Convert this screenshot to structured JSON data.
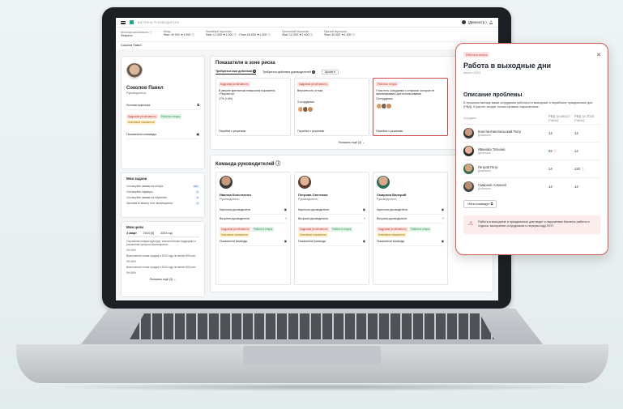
{
  "app": {
    "crumb": "ВИТРИНА РУКОВОДИТЕЛЯ",
    "user_label": "(Демонстр.)"
  },
  "stats": [
    {
      "label": "Штатная численность ⓘ",
      "value": "Февраль"
    },
    {
      "label": "Фонд:",
      "value": "Факт 40 000 ▼1 000 ⓘ"
    },
    {
      "label": "Линейный персонал:",
      "value": "Факт 12 000 ▼1 000 ⓘ · План 16 000 ▼1 000 ⓘ"
    },
    {
      "label": "Проектный персонал:",
      "value": "Факт 12 000 ▼1 000 ⓘ"
    },
    {
      "label": "Прочий персонал:",
      "value": "Факт 40 000 ▼1 000 ⓘ"
    }
  ],
  "page_owner": "Соколов Павел",
  "profile": {
    "name": "Соколов Павел",
    "role": "Руководитель",
    "personal_card": "Личная карточка",
    "tags": [
      "Кадровая устойчивость",
      "Работа в отпуск",
      "Ключевые показатели"
    ],
    "team_metrics": "Показатели команды"
  },
  "tasks": {
    "title": "Мои задачи",
    "items": [
      {
        "label": "Согласуйте заявки на отпуск",
        "badge": "99+"
      },
      {
        "label": "Согласуйте офферы",
        "badge": "2"
      },
      {
        "label": "Согласуйте заявки на обучение",
        "badge": "2"
      },
      {
        "label": "Заполните анкету тест-мониторинга",
        "badge": "3"
      }
    ]
  },
  "goals": {
    "title": "Мои цели",
    "tabs": [
      "3 кварт",
      "2024 (6)",
      "2024 год"
    ],
    "items": [
      "Улучшение инфраструктуры, аналитическая поддержка и улучшение процесса мониторинга...",
      "Выполнение плана продаж в 2023 году не менее 800 млн",
      "Выполнение плана продаж в 2023 году не менее 800 млн"
    ],
    "progress": [
      "0%   50%",
      "0%   50%",
      "0%   50%"
    ],
    "show_more": "Показать ещё (3)  ⌄"
  },
  "risk": {
    "title": "Показатели в зоне риска",
    "tab_action": "Требуются мои действия",
    "tab_action_count": "3",
    "tab_managers": "Требуются действия руководителей",
    "tab_managers_count": "3",
    "filter": "Архив ▾",
    "cards": [
      {
        "tag": "Кадровая устойчивость",
        "text": "В августе критически повысился показатель «Текучесть»",
        "extra": "17% (+4%)",
        "go": "Перейти к решению"
      },
      {
        "tag": "Кадровая устойчивость",
        "text": "Вероятность оттока",
        "extra": "3 сотрудника",
        "go": "Перейти к решению"
      },
      {
        "tag": "Работа в отпуск",
        "text": "У вас есть сотрудники с отпуском, которые не запланированы для использования",
        "extra": "3 сотрудника",
        "go": "Перейти к решению"
      }
    ],
    "show_more": "Показать ещё (3)  ⌄"
  },
  "team": {
    "title": "Команда руководителей ⓘ",
    "members": [
      {
        "name": "Иванов Константин",
        "role": "Руководитель"
      },
      {
        "name": "Петрова Светлана",
        "role": "Руководитель"
      },
      {
        "name": "Смирнов Валерий",
        "role": "Руководитель"
      }
    ],
    "card_label": "Карточка руководителя",
    "showcase_label": "Витрина руководителя",
    "metrics_label": "Показатели команды",
    "tags": [
      "Кадровая устойчивость",
      "Работа в отпуск",
      "Ключевые показатели"
    ]
  },
  "popup": {
    "tag": "Работа в отпуск",
    "title": "Работа в выходные дни",
    "period": "Август 2024",
    "section": "Описание проблемы",
    "description": "В прошлом месяце ваши сотрудники работали в выходные и нерабочие праздничные дни (РВД). В расчет входят только прямые подчиненные.",
    "columns": [
      "Сотрудник",
      "РВД за август",
      "РВД за 2024"
    ],
    "column_subs": [
      "",
      "(часы)",
      "(часы)"
    ],
    "rows": [
      {
        "name": "Константинопольский Петр",
        "role": "Должность",
        "month": "14",
        "year": "14",
        "month_warn": false,
        "year_warn": false
      },
      {
        "name": "Иванова Татьяна",
        "role": "Должность",
        "month": "32",
        "year": "14",
        "month_warn": true,
        "year_warn": false
      },
      {
        "name": "Петров Петр",
        "role": "Должность",
        "month": "14",
        "year": "120",
        "month_warn": false,
        "year_warn": true
      },
      {
        "name": "Смирнов Алексей",
        "role": "Должность",
        "month": "14",
        "year": "14",
        "month_warn": false,
        "year_warn": false
      }
    ],
    "team_link": "«Моя команда» ⧉",
    "alert": "Работа в выходные и праздничные дни ведет к нарушению баланса работы и отдыха, выгоранию сотрудников и перерасходу ФОТ."
  }
}
